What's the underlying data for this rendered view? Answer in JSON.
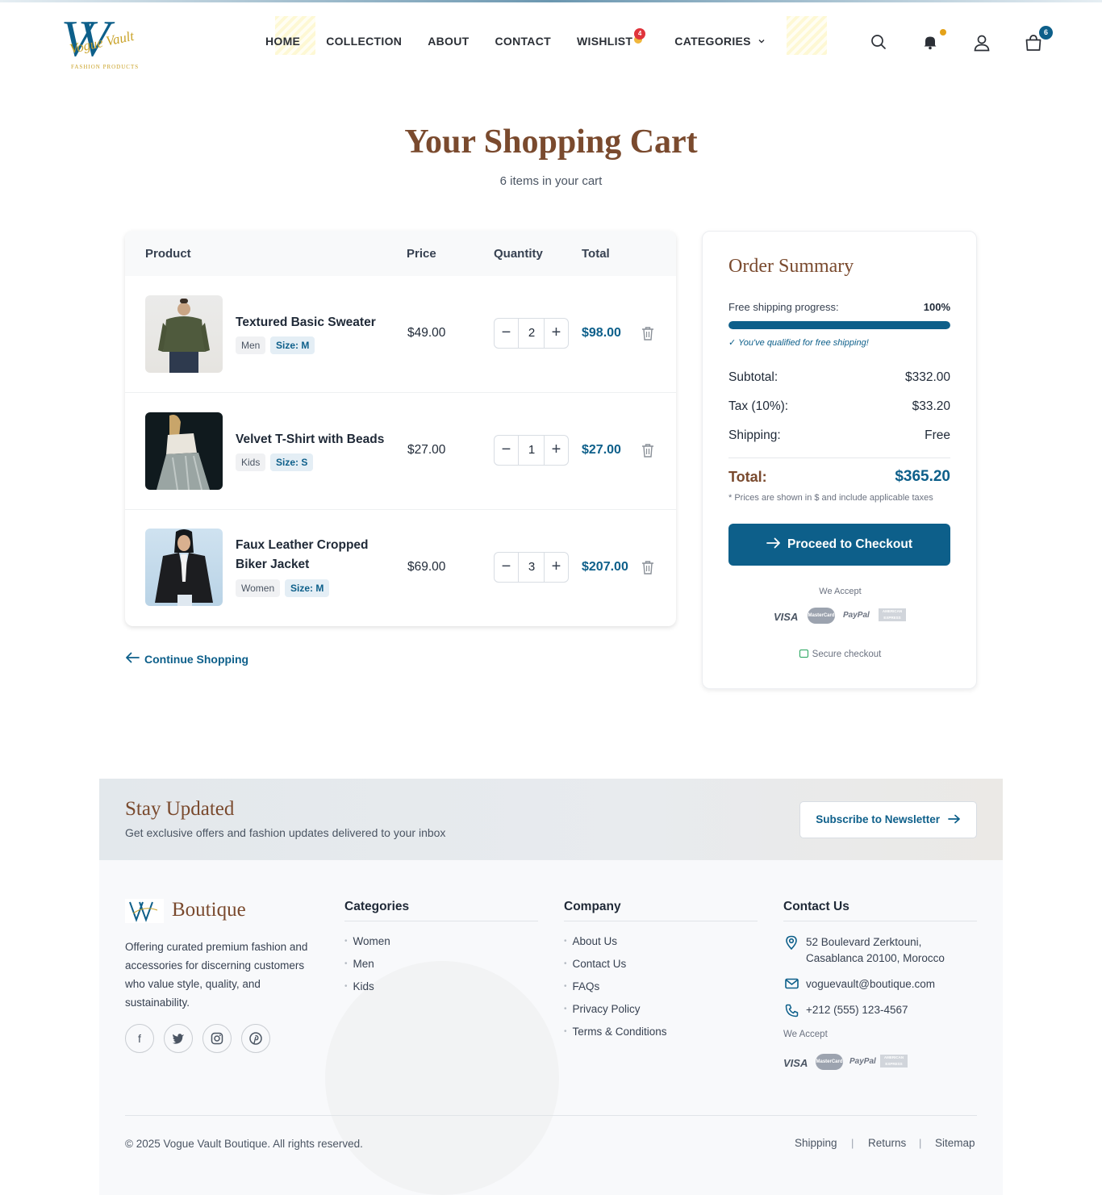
{
  "brand": {
    "logo_letters": "VV",
    "logo_script": "Vogue Vault",
    "logo_tagline": "FASHION PRODUCTS",
    "accent_color": "#0d5f8a",
    "title_color": "#7a4a2e"
  },
  "nav": {
    "items": [
      {
        "label": "HOME"
      },
      {
        "label": "COLLECTION"
      },
      {
        "label": "ABOUT"
      },
      {
        "label": "CONTACT"
      },
      {
        "label": "WISHLIST",
        "badge": "4"
      },
      {
        "label": "CATEGORIES"
      }
    ],
    "icons": [
      "search-icon",
      "bell-icon",
      "user-icon",
      "shopping-bag-icon"
    ],
    "cart_count": "6"
  },
  "page": {
    "title": "Your Shopping Cart",
    "subtitle": "6 items in your cart"
  },
  "cart": {
    "headers": {
      "product": "Product",
      "price": "Price",
      "quantity": "Quantity",
      "total": "Total"
    },
    "items": [
      {
        "name": "Textured Basic Sweater",
        "category": "Men",
        "size": "Size: M",
        "price": "$49.00",
        "qty": "2",
        "total": "$98.00"
      },
      {
        "name": "Velvet T-Shirt with Beads",
        "category": "Kids",
        "size": "Size: S",
        "price": "$27.00",
        "qty": "1",
        "total": "$27.00"
      },
      {
        "name": "Faux Leather Cropped Biker Jacket",
        "category": "Women",
        "size": "Size: M",
        "price": "$69.00",
        "qty": "3",
        "total": "$207.00"
      }
    ],
    "continue_label": "Continue Shopping"
  },
  "summary": {
    "title": "Order Summary",
    "progress_label": "Free shipping progress:",
    "progress_pct": "100%",
    "progress_value": 1.0,
    "qualified": "✓ You've qualified for free shipping!",
    "subtotal_label": "Subtotal:",
    "subtotal": "$332.00",
    "tax_label": "Tax (10%):",
    "tax": "$33.20",
    "shipping_label": "Shipping:",
    "shipping": "Free",
    "total_label": "Total:",
    "total": "$365.20",
    "note": "* Prices are shown in $ and include applicable taxes",
    "checkout_label": "Proceed to Checkout",
    "we_accept": "We Accept",
    "cards": [
      "VISA",
      "MasterCard",
      "PayPal",
      "AMERICAN EXPRESS"
    ],
    "secure": "Secure checkout"
  },
  "newsletter": {
    "title": "Stay Updated",
    "text": "Get exclusive offers and fashion updates delivered to your inbox",
    "button": "Subscribe to Newsletter"
  },
  "footer": {
    "brand_name": "Boutique",
    "description": "Offering curated premium fashion and accessories for discerning customers who value style, quality, and sustainability.",
    "social": [
      "facebook-icon",
      "twitter-icon",
      "instagram-icon",
      "pinterest-icon"
    ],
    "categories_title": "Categories",
    "categories": [
      "Women",
      "Men",
      "Kids"
    ],
    "company_title": "Company",
    "company": [
      "About Us",
      "Contact Us",
      "FAQs",
      "Privacy Policy",
      "Terms & Conditions"
    ],
    "contact_title": "Contact Us",
    "address_line1": "52 Boulevard Zerktouni,",
    "address_line2": "Casablanca 20100, Morocco",
    "email": "voguevault@boutique.com",
    "phone": "+212 (555) 123-4567",
    "we_accept": "We Accept",
    "copyright": "© 2025 Vogue Vault Boutique. All rights reserved.",
    "bottom_links": [
      "Shipping",
      "Returns",
      "Sitemap"
    ]
  }
}
